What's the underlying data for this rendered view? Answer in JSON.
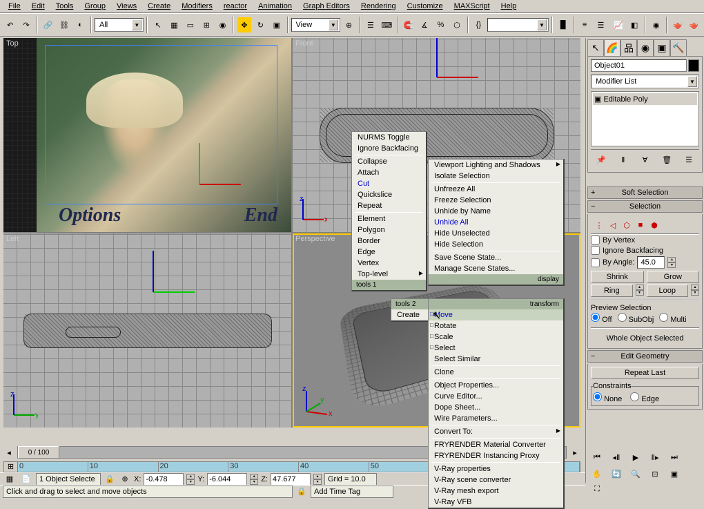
{
  "menus": [
    "File",
    "Edit",
    "Tools",
    "Group",
    "Views",
    "Create",
    "Modifiers",
    "reactor",
    "Animation",
    "Graph Editors",
    "Rendering",
    "Customize",
    "MAXScript",
    "Help"
  ],
  "toolbar": {
    "selset": "All",
    "refsys": "View"
  },
  "viewports": {
    "top": "Top",
    "front": "Front",
    "left": "Left",
    "persp": "Perspective",
    "photo_left": "Options",
    "photo_right": "End"
  },
  "panel": {
    "objname": "Object01",
    "modlist": "Modifier List",
    "modstack": "Editable Poly",
    "rollouts": {
      "softsel": "Soft Selection",
      "selection": "Selection",
      "editgeom": "Edit Geometry",
      "repeat": "Repeat Last",
      "constraints": "Constraints"
    },
    "sel": {
      "byvertex": "By Vertex",
      "ignoreback": "Ignore Backfacing",
      "byangle": "By Angle:",
      "angle_val": "45.0",
      "shrink": "Shrink",
      "grow": "Grow",
      "ring": "Ring",
      "loop": "Loop",
      "preview": "Preview Selection",
      "off": "Off",
      "subobj": "SubObj",
      "multi": "Multi",
      "status": "Whole Object Selected"
    },
    "constraints": {
      "none": "None",
      "edge": "Edge"
    }
  },
  "ctx1": {
    "items": [
      "NURMS Toggle",
      "Ignore Backfacing",
      "Collapse",
      "Attach",
      "Cut",
      "Quickslice",
      "Repeat",
      "Element",
      "Polygon",
      "Border",
      "Edge",
      "Vertex",
      "Top-level"
    ]
  },
  "ctx2": {
    "hdr": "tools 1",
    "hdr_r": "display",
    "items": [
      "Viewport Lighting and Shadows",
      "Isolate Selection",
      "Unfreeze All",
      "Freeze Selection",
      "Unhide by Name",
      "Unhide All",
      "Hide Unselected",
      "Hide Selection",
      "Save Scene State...",
      "Manage Scene States..."
    ]
  },
  "ctx3": {
    "hdr": "tools 2",
    "hdr_create": "Create",
    "hdr_r": "transform",
    "items": [
      "Move",
      "Rotate",
      "Scale",
      "Select",
      "Select Similar",
      "Clone",
      "Object Properties...",
      "Curve Editor...",
      "Dope Sheet...",
      "Wire Parameters...",
      "Convert To:",
      "FRYRENDER Material Converter",
      "FRYRENDER Instancing Proxy",
      "V-Ray properties",
      "V-Ray scene converter",
      "V-Ray mesh export",
      "V-Ray VFB"
    ]
  },
  "time": {
    "slider": "0 / 100"
  },
  "status": {
    "sel": "1 Object Selecte",
    "x": "-0.478",
    "y": "-6.044",
    "z": "47.677",
    "grid": "Grid = 10.0",
    "addtag": "Add Time Tag",
    "prompt": "Click and drag to select and move objects"
  }
}
